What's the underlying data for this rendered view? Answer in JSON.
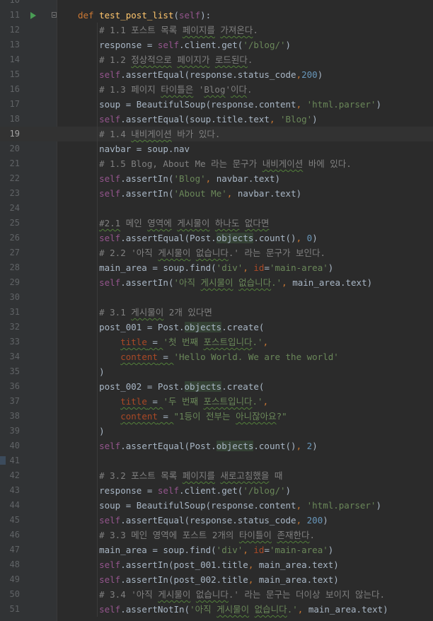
{
  "editor": {
    "current_line": 19,
    "lines": [
      {
        "n": "10",
        "segs": []
      },
      {
        "n": "11",
        "run": true,
        "fold": true,
        "segs": [
          {
            "t": "def ",
            "c": "kw"
          },
          {
            "t": "test_post_list",
            "c": "fn"
          },
          {
            "t": "(",
            "c": ""
          },
          {
            "t": "self",
            "c": "self"
          },
          {
            "t": "):",
            "c": ""
          }
        ]
      },
      {
        "n": "12",
        "segs": [
          {
            "t": "    # 1.1 포스트 목록 ",
            "c": "cm"
          },
          {
            "t": "페이지를",
            "c": "cm sq"
          },
          {
            "t": " ",
            "c": "cm"
          },
          {
            "t": "가져온다",
            "c": "cm sq"
          },
          {
            "t": ".",
            "c": "cm"
          }
        ]
      },
      {
        "n": "13",
        "segs": [
          {
            "t": "    response = ",
            "c": ""
          },
          {
            "t": "self",
            "c": "self"
          },
          {
            "t": ".client.get(",
            "c": ""
          },
          {
            "t": "'/blog/'",
            "c": "str"
          },
          {
            "t": ")",
            "c": ""
          }
        ]
      },
      {
        "n": "14",
        "segs": [
          {
            "t": "    # 1.2 ",
            "c": "cm"
          },
          {
            "t": "정상적으로",
            "c": "cm sq"
          },
          {
            "t": " ",
            "c": "cm"
          },
          {
            "t": "페이지가",
            "c": "cm sq"
          },
          {
            "t": " ",
            "c": "cm"
          },
          {
            "t": "로드된다",
            "c": "cm sq"
          },
          {
            "t": ".",
            "c": "cm"
          }
        ]
      },
      {
        "n": "15",
        "segs": [
          {
            "t": "    ",
            "c": ""
          },
          {
            "t": "self",
            "c": "self"
          },
          {
            "t": ".assertEqual(response.status_code",
            "c": ""
          },
          {
            "t": ",",
            "c": "kw"
          },
          {
            "t": "200",
            "c": "num"
          },
          {
            "t": ")",
            "c": ""
          }
        ]
      },
      {
        "n": "16",
        "segs": [
          {
            "t": "    # 1.3 페이지 ",
            "c": "cm"
          },
          {
            "t": "타이틀은",
            "c": "cm sq"
          },
          {
            "t": " '",
            "c": "cm"
          },
          {
            "t": "Blog",
            "c": "cm sq"
          },
          {
            "t": "'",
            "c": "cm"
          },
          {
            "t": "이다",
            "c": "cm sq"
          },
          {
            "t": ".",
            "c": "cm"
          }
        ]
      },
      {
        "n": "17",
        "segs": [
          {
            "t": "    soup = BeautifulSoup(response.content",
            "c": ""
          },
          {
            "t": ", ",
            "c": "kw"
          },
          {
            "t": "'html.parser'",
            "c": "str"
          },
          {
            "t": ")",
            "c": ""
          }
        ]
      },
      {
        "n": "18",
        "segs": [
          {
            "t": "    ",
            "c": ""
          },
          {
            "t": "self",
            "c": "self"
          },
          {
            "t": ".assertEqual(soup.title.text",
            "c": ""
          },
          {
            "t": ", ",
            "c": "kw"
          },
          {
            "t": "'Blog'",
            "c": "str"
          },
          {
            "t": ")",
            "c": ""
          }
        ]
      },
      {
        "n": "19",
        "segs": [
          {
            "t": "    # 1.4 ",
            "c": "cm"
          },
          {
            "t": "내비게이션",
            "c": "cm sq"
          },
          {
            "t": " 바가 있다.",
            "c": "cm"
          }
        ]
      },
      {
        "n": "20",
        "segs": [
          {
            "t": "    navbar = soup.nav",
            "c": ""
          }
        ]
      },
      {
        "n": "21",
        "segs": [
          {
            "t": "    # 1.5 Blog, About Me 라는 문구가 ",
            "c": "cm"
          },
          {
            "t": "내비게이션",
            "c": "cm sq"
          },
          {
            "t": " 바에 있다.",
            "c": "cm"
          }
        ]
      },
      {
        "n": "22",
        "segs": [
          {
            "t": "    ",
            "c": ""
          },
          {
            "t": "self",
            "c": "self"
          },
          {
            "t": ".assertIn(",
            "c": ""
          },
          {
            "t": "'Blog'",
            "c": "str"
          },
          {
            "t": ", ",
            "c": "kw"
          },
          {
            "t": "navbar.text)",
            "c": ""
          }
        ]
      },
      {
        "n": "23",
        "segs": [
          {
            "t": "    ",
            "c": ""
          },
          {
            "t": "self",
            "c": "self"
          },
          {
            "t": ".assertIn(",
            "c": ""
          },
          {
            "t": "'About Me'",
            "c": "str"
          },
          {
            "t": ", ",
            "c": "kw"
          },
          {
            "t": "navbar.text)",
            "c": ""
          }
        ]
      },
      {
        "n": "24",
        "segs": []
      },
      {
        "n": "25",
        "segs": [
          {
            "t": "    ",
            "c": ""
          },
          {
            "t": "#2.1",
            "c": "cm sq"
          },
          {
            "t": " 메인 ",
            "c": "cm"
          },
          {
            "t": "영역에",
            "c": "cm sq"
          },
          {
            "t": " ",
            "c": "cm"
          },
          {
            "t": "게시물이",
            "c": "cm sq"
          },
          {
            "t": " ",
            "c": "cm"
          },
          {
            "t": "하나도",
            "c": "cm sq"
          },
          {
            "t": " ",
            "c": "cm"
          },
          {
            "t": "없다면",
            "c": "cm sq"
          }
        ]
      },
      {
        "n": "26",
        "segs": [
          {
            "t": "    ",
            "c": ""
          },
          {
            "t": "self",
            "c": "self"
          },
          {
            "t": ".assertEqual(Post.",
            "c": ""
          },
          {
            "t": "objects",
            "c": "hl"
          },
          {
            "t": ".count()",
            "c": ""
          },
          {
            "t": ", ",
            "c": "kw"
          },
          {
            "t": "0",
            "c": "num"
          },
          {
            "t": ")",
            "c": ""
          }
        ]
      },
      {
        "n": "27",
        "segs": [
          {
            "t": "    # 2.2 '아직 ",
            "c": "cm"
          },
          {
            "t": "게시물이",
            "c": "cm sq"
          },
          {
            "t": " ",
            "c": "cm"
          },
          {
            "t": "없습니다",
            "c": "cm sq"
          },
          {
            "t": ".' 라는 문구가 보인다.",
            "c": "cm"
          }
        ]
      },
      {
        "n": "28",
        "segs": [
          {
            "t": "    main_area = soup.find(",
            "c": ""
          },
          {
            "t": "'div'",
            "c": "str"
          },
          {
            "t": ", ",
            "c": "kw"
          },
          {
            "t": "id",
            "c": "param"
          },
          {
            "t": "=",
            "c": ""
          },
          {
            "t": "'main-area'",
            "c": "str"
          },
          {
            "t": ")",
            "c": ""
          }
        ]
      },
      {
        "n": "29",
        "segs": [
          {
            "t": "    ",
            "c": ""
          },
          {
            "t": "self",
            "c": "self"
          },
          {
            "t": ".assertIn(",
            "c": ""
          },
          {
            "t": "'아직 ",
            "c": "str"
          },
          {
            "t": "게시물이",
            "c": "str sq"
          },
          {
            "t": " ",
            "c": "str"
          },
          {
            "t": "없습니다",
            "c": "str sq"
          },
          {
            "t": ".'",
            "c": "str"
          },
          {
            "t": ", ",
            "c": "kw"
          },
          {
            "t": "main_area.text)",
            "c": ""
          }
        ]
      },
      {
        "n": "30",
        "segs": []
      },
      {
        "n": "31",
        "segs": [
          {
            "t": "    # 3.1 ",
            "c": "cm"
          },
          {
            "t": "게시물이",
            "c": "cm sq"
          },
          {
            "t": " 2개 있다면",
            "c": "cm"
          }
        ]
      },
      {
        "n": "32",
        "segs": [
          {
            "t": "    post_001 = Post.",
            "c": ""
          },
          {
            "t": "objects",
            "c": "hl"
          },
          {
            "t": ".create(",
            "c": ""
          }
        ]
      },
      {
        "n": "33",
        "segs": [
          {
            "t": "        ",
            "c": ""
          },
          {
            "t": "title",
            "c": "param sq"
          },
          {
            "t": " = ",
            "c": "sq"
          },
          {
            "t": "'첫 번째 ",
            "c": "str"
          },
          {
            "t": "포스트입니다",
            "c": "str sq"
          },
          {
            "t": ".'",
            "c": "str"
          },
          {
            "t": ",",
            "c": "kw"
          }
        ]
      },
      {
        "n": "34",
        "segs": [
          {
            "t": "        ",
            "c": ""
          },
          {
            "t": "content",
            "c": "param sq"
          },
          {
            "t": " = ",
            "c": "sq"
          },
          {
            "t": "'Hello World. We are the world'",
            "c": "str"
          }
        ]
      },
      {
        "n": "35",
        "segs": [
          {
            "t": "    )",
            "c": ""
          }
        ]
      },
      {
        "n": "36",
        "segs": [
          {
            "t": "    post_002 = Post.",
            "c": ""
          },
          {
            "t": "objects",
            "c": "hl"
          },
          {
            "t": ".create(",
            "c": ""
          }
        ]
      },
      {
        "n": "37",
        "segs": [
          {
            "t": "        ",
            "c": ""
          },
          {
            "t": "title",
            "c": "param sq"
          },
          {
            "t": " = ",
            "c": "sq"
          },
          {
            "t": "'두 번째 ",
            "c": "str"
          },
          {
            "t": "포스트입니다",
            "c": "str sq"
          },
          {
            "t": ".'",
            "c": "str"
          },
          {
            "t": ",",
            "c": "kw"
          }
        ]
      },
      {
        "n": "38",
        "segs": [
          {
            "t": "        ",
            "c": ""
          },
          {
            "t": "content",
            "c": "param sq"
          },
          {
            "t": " = ",
            "c": "sq"
          },
          {
            "t": "\"1등이 전부는 ",
            "c": "str"
          },
          {
            "t": "아니잖아요",
            "c": "str sq"
          },
          {
            "t": "?\"",
            "c": "str"
          }
        ]
      },
      {
        "n": "39",
        "segs": [
          {
            "t": "    )",
            "c": ""
          }
        ]
      },
      {
        "n": "40",
        "segs": [
          {
            "t": "    ",
            "c": ""
          },
          {
            "t": "self",
            "c": "self"
          },
          {
            "t": ".assertEqual(Post.",
            "c": ""
          },
          {
            "t": "objects",
            "c": "hl"
          },
          {
            "t": ".count()",
            "c": ""
          },
          {
            "t": ", ",
            "c": "kw"
          },
          {
            "t": "2",
            "c": "num"
          },
          {
            "t": ")",
            "c": ""
          }
        ]
      },
      {
        "n": "41",
        "segs": []
      },
      {
        "n": "42",
        "segs": [
          {
            "t": "    # 3.2 포스트 목록 ",
            "c": "cm"
          },
          {
            "t": "페이지를",
            "c": "cm sq"
          },
          {
            "t": " ",
            "c": "cm"
          },
          {
            "t": "새로고침했을",
            "c": "cm sq"
          },
          {
            "t": " 때",
            "c": "cm"
          }
        ]
      },
      {
        "n": "43",
        "segs": [
          {
            "t": "    response = ",
            "c": ""
          },
          {
            "t": "self",
            "c": "self"
          },
          {
            "t": ".client.get(",
            "c": ""
          },
          {
            "t": "'/blog/'",
            "c": "str"
          },
          {
            "t": ")",
            "c": ""
          }
        ]
      },
      {
        "n": "44",
        "segs": [
          {
            "t": "    soup = BeautifulSoup(response.content",
            "c": ""
          },
          {
            "t": ", ",
            "c": "kw"
          },
          {
            "t": "'html.parser'",
            "c": "str"
          },
          {
            "t": ")",
            "c": ""
          }
        ]
      },
      {
        "n": "45",
        "segs": [
          {
            "t": "    ",
            "c": ""
          },
          {
            "t": "self",
            "c": "self"
          },
          {
            "t": ".assertEqual(response.status_code",
            "c": ""
          },
          {
            "t": ", ",
            "c": "kw"
          },
          {
            "t": "200",
            "c": "num"
          },
          {
            "t": ")",
            "c": ""
          }
        ]
      },
      {
        "n": "46",
        "segs": [
          {
            "t": "    # 3.3 메인 영역에 포스트 2개의 ",
            "c": "cm"
          },
          {
            "t": "타이틀이",
            "c": "cm sq"
          },
          {
            "t": " ",
            "c": "cm"
          },
          {
            "t": "존재한다",
            "c": "cm sq"
          },
          {
            "t": ".",
            "c": "cm"
          }
        ]
      },
      {
        "n": "47",
        "segs": [
          {
            "t": "    main_area = soup.find(",
            "c": ""
          },
          {
            "t": "'div'",
            "c": "str"
          },
          {
            "t": ", ",
            "c": "kw"
          },
          {
            "t": "id",
            "c": "param"
          },
          {
            "t": "=",
            "c": ""
          },
          {
            "t": "'main-area'",
            "c": "str"
          },
          {
            "t": ")",
            "c": ""
          }
        ]
      },
      {
        "n": "48",
        "segs": [
          {
            "t": "    ",
            "c": ""
          },
          {
            "t": "self",
            "c": "self"
          },
          {
            "t": ".assertIn(post_001.title",
            "c": ""
          },
          {
            "t": ", ",
            "c": "kw"
          },
          {
            "t": "main_area.text)",
            "c": ""
          }
        ]
      },
      {
        "n": "49",
        "segs": [
          {
            "t": "    ",
            "c": ""
          },
          {
            "t": "self",
            "c": "self"
          },
          {
            "t": ".assertIn(post_002.title",
            "c": ""
          },
          {
            "t": ", ",
            "c": "kw"
          },
          {
            "t": "main_area.text)",
            "c": ""
          }
        ]
      },
      {
        "n": "50",
        "segs": [
          {
            "t": "    # 3.4 '아직 ",
            "c": "cm"
          },
          {
            "t": "게시물이",
            "c": "cm sq"
          },
          {
            "t": " ",
            "c": "cm"
          },
          {
            "t": "없습니다",
            "c": "cm sq"
          },
          {
            "t": ".' 라는 문구는 더이상 보이지 않는다.",
            "c": "cm"
          }
        ]
      },
      {
        "n": "51",
        "segs": [
          {
            "t": "    ",
            "c": ""
          },
          {
            "t": "self",
            "c": "self"
          },
          {
            "t": ".assertNotIn(",
            "c": ""
          },
          {
            "t": "'아직 ",
            "c": "str"
          },
          {
            "t": "게시물이",
            "c": "str sq"
          },
          {
            "t": " ",
            "c": "str"
          },
          {
            "t": "없습니다",
            "c": "str sq"
          },
          {
            "t": ".'",
            "c": "str"
          },
          {
            "t": ", ",
            "c": "kw"
          },
          {
            "t": "main_area.text)",
            "c": ""
          }
        ]
      }
    ]
  },
  "icons": {
    "run": "run-test-icon",
    "fold": "fold-icon"
  },
  "colors": {
    "background": "#2b2b2b",
    "gutter": "#313335",
    "keyword": "#cc7832",
    "function": "#ffc66d",
    "self": "#94558d",
    "string": "#6a8759",
    "number": "#6897bb",
    "comment": "#808080"
  }
}
